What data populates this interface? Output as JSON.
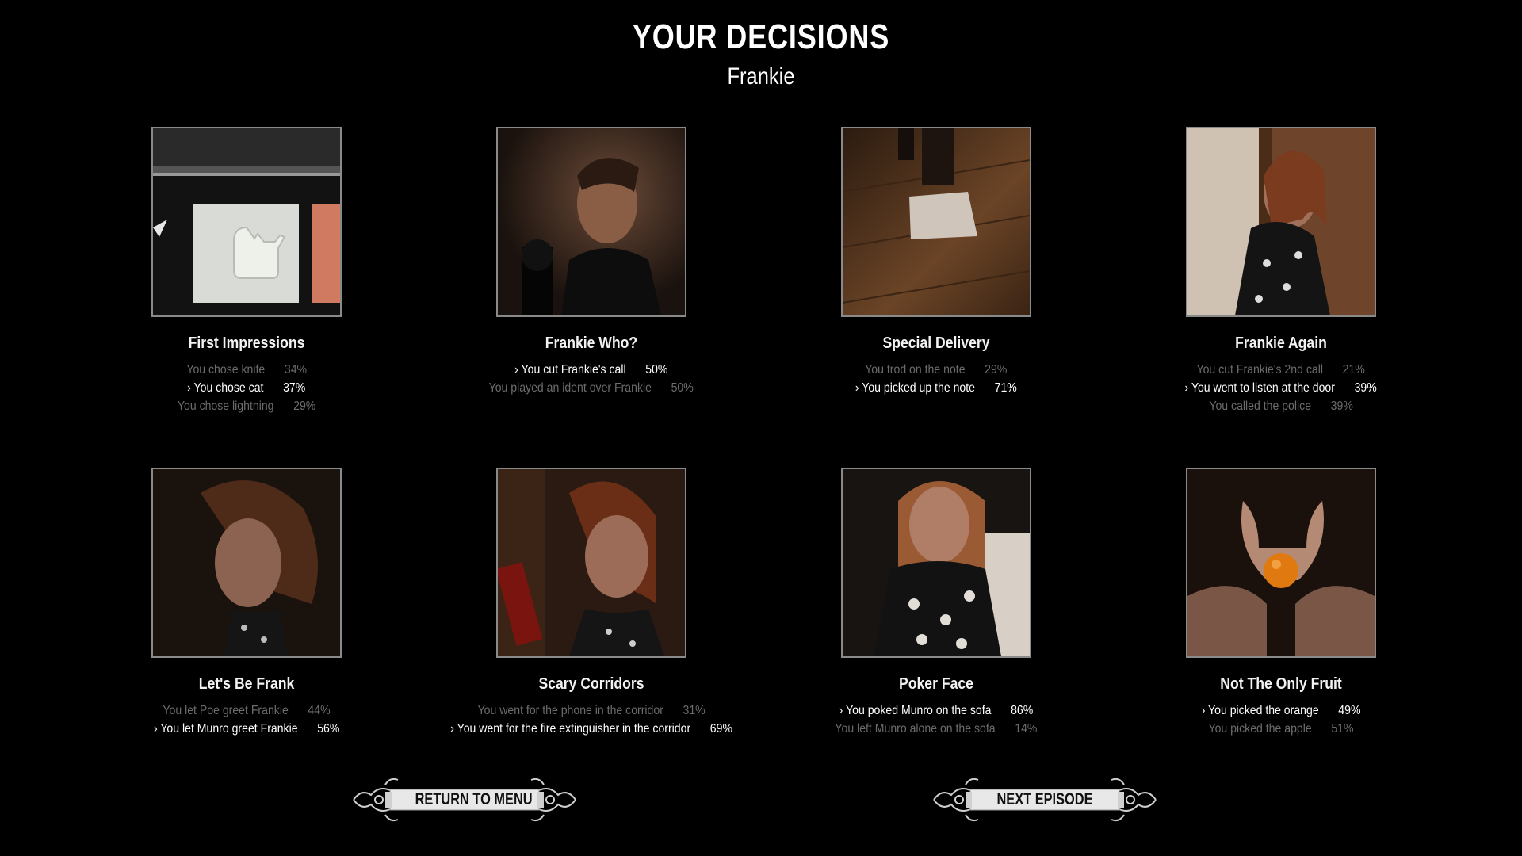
{
  "header": {
    "title": "YOUR DECISIONS",
    "subtitle": "Frankie"
  },
  "cards": [
    {
      "title": "First Impressions",
      "image": "cat-card-image",
      "choices": [
        {
          "text": "You chose knife",
          "percent": "34%",
          "selected": false
        },
        {
          "text": "› You chose cat",
          "percent": "37%",
          "selected": true
        },
        {
          "text": "You chose lightning",
          "percent": "29%",
          "selected": false
        }
      ]
    },
    {
      "title": "Frankie Who?",
      "image": "man-with-microphone-image",
      "choices": [
        {
          "text": "› You cut Frankie's call",
          "percent": "50%",
          "selected": true
        },
        {
          "text": "You played an ident over Frankie",
          "percent": "50%",
          "selected": false
        }
      ]
    },
    {
      "title": "Special Delivery",
      "image": "note-on-floor-image",
      "choices": [
        {
          "text": "You trod on the note",
          "percent": "29%",
          "selected": false
        },
        {
          "text": "› You picked up the note",
          "percent": "71%",
          "selected": true
        }
      ]
    },
    {
      "title": "Frankie Again",
      "image": "woman-by-door-image",
      "choices": [
        {
          "text": "You cut Frankie's 2nd call",
          "percent": "21%",
          "selected": false
        },
        {
          "text": "› You went to listen at the door",
          "percent": "39%",
          "selected": true
        },
        {
          "text": "You called the police",
          "percent": "39%",
          "selected": false
        }
      ]
    },
    {
      "title": "Let's Be Frank",
      "image": "woman-profile-image",
      "choices": [
        {
          "text": "You let Poe greet Frankie",
          "percent": "44%",
          "selected": false
        },
        {
          "text": "› You let Munro greet Frankie",
          "percent": "56%",
          "selected": true
        }
      ]
    },
    {
      "title": "Scary Corridors",
      "image": "woman-corridor-image",
      "choices": [
        {
          "text": "You went for the phone in the corridor",
          "percent": "31%",
          "selected": false
        },
        {
          "text": "› You went for the fire extinguisher in the corridor",
          "percent": "69%",
          "selected": true
        }
      ]
    },
    {
      "title": "Poker Face",
      "image": "woman-on-sofa-image",
      "choices": [
        {
          "text": "› You poked Munro on the sofa",
          "percent": "86%",
          "selected": true
        },
        {
          "text": "You left Munro alone on the sofa",
          "percent": "14%",
          "selected": false
        }
      ]
    },
    {
      "title": "Not The Only Fruit",
      "image": "hands-holding-orange-image",
      "choices": [
        {
          "text": "› You picked the orange",
          "percent": "49%",
          "selected": true
        },
        {
          "text": "You picked the apple",
          "percent": "51%",
          "selected": false
        }
      ]
    }
  ],
  "buttons": {
    "return_to_menu": "RETURN TO MENU",
    "next_episode": "NEXT EPISODE"
  }
}
